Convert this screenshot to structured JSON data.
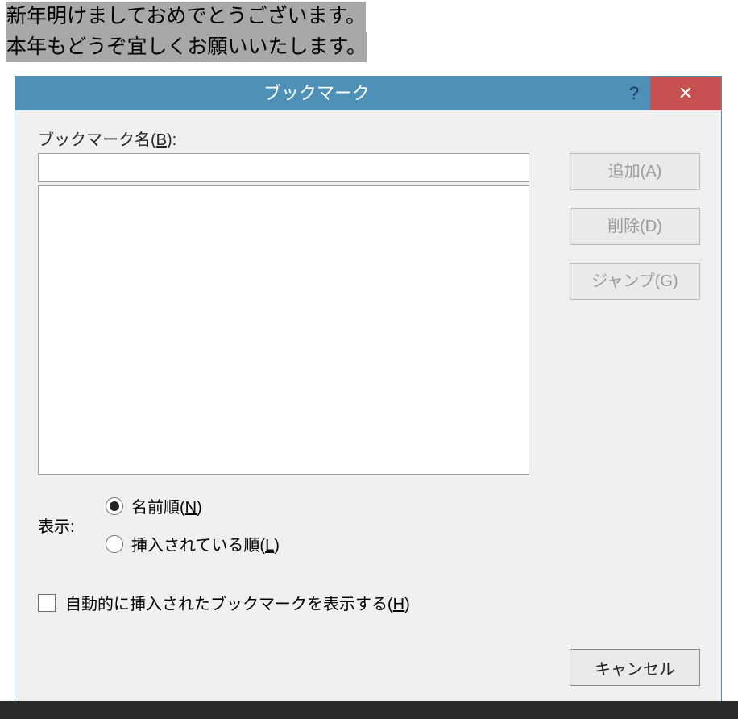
{
  "document": {
    "line1": "新年明けましておめでとうございます。",
    "line2": "本年もどうぞ宜しくお願いいたします。"
  },
  "dialog": {
    "title": "ブックマーク",
    "help": "?",
    "close": "✕",
    "name_label_prefix": "ブックマーク名(",
    "name_label_hotkey": "B",
    "name_label_suffix": "):",
    "name_value": "",
    "add_btn": "追加(A)",
    "delete_btn": "削除(D)",
    "goto_btn": "ジャンプ(G)",
    "sort_label": "表示:",
    "sort_name_prefix": "名前順(",
    "sort_name_hotkey": "N",
    "sort_name_suffix": ")",
    "sort_location_prefix": "挿入されている順(",
    "sort_location_hotkey": "L",
    "sort_location_suffix": ")",
    "hidden_prefix": "自動的に挿入されたブックマークを表示する(",
    "hidden_hotkey": "H",
    "hidden_suffix": ")",
    "cancel_btn": "キャンセル"
  }
}
